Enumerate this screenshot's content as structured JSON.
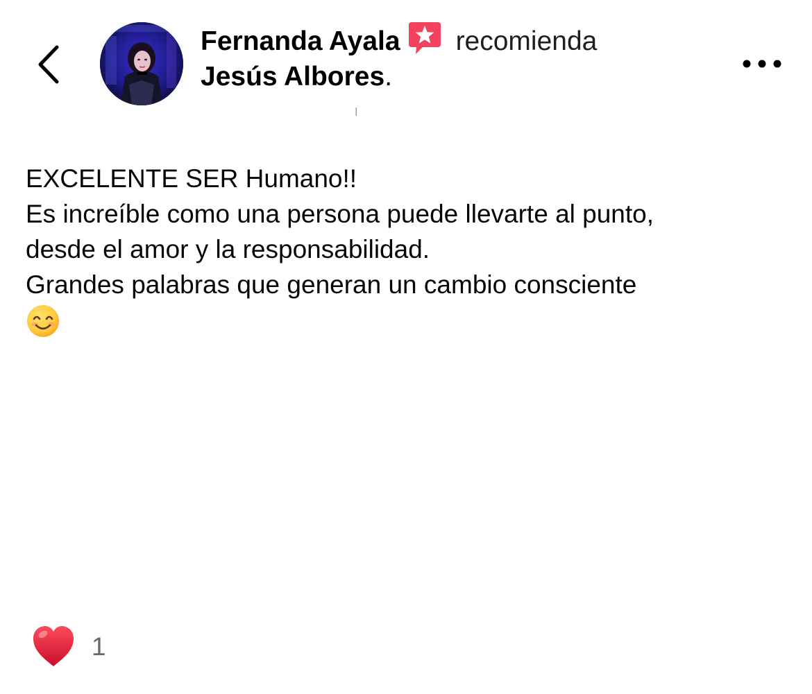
{
  "post": {
    "author": "Fernanda Ayala",
    "action": "recomienda",
    "recipient": "Jesús Albores",
    "recipient_suffix": ".",
    "body_lines": [
      "EXCELENTE SER Humano!!",
      "Es increíble como una persona puede llevarte al punto,",
      "desde el amor y la responsabilidad.",
      "Grandes palabras que generan un cambio consciente"
    ],
    "emoji": "smiling-face-with-smiling-eyes"
  },
  "reactions": {
    "type": "heart",
    "count": "1"
  },
  "icons": {
    "back": "chevron-left-icon",
    "more": "more-options-icon",
    "recommend_badge": "recommendation-star-icon"
  },
  "colors": {
    "recommend_badge": "#f3425f",
    "heart": "#e0203a",
    "count_text": "#65676b"
  }
}
